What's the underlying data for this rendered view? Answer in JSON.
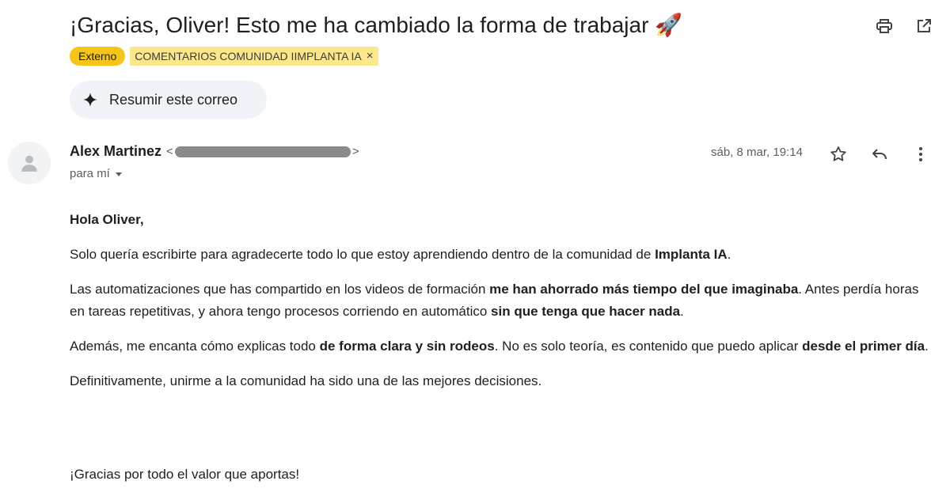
{
  "email": {
    "subject": "¡Gracias, Oliver! Esto me ha cambiado la forma de trabajar",
    "subject_emoji": "🚀",
    "labels": {
      "external": "Externo",
      "tag": "COMENTARIOS COMUNIDAD IIMPLANTA IA",
      "tag_remove": "×"
    },
    "summarize_label": "Resumir este correo",
    "sender": {
      "name": "Alex Martinez",
      "email_open": "<",
      "email_close": ">"
    },
    "to_label": "para mí",
    "date": "sáb, 8 mar, 19:14",
    "body": {
      "greeting": "Hola Oliver,",
      "p1": {
        "a": "Solo quería escribirte para agradecerte todo lo que estoy aprendiendo dentro de la comunidad de ",
        "b": "Implanta IA",
        "c": "."
      },
      "p2": {
        "a": "Las automatizaciones que has compartido en los videos de formación ",
        "b": "me han ahorrado más tiempo del que imaginaba",
        "c": ". Antes perdía horas en tareas repetitivas, y ahora tengo procesos corriendo en automático ",
        "d": "sin que tenga que hacer nada",
        "e": "."
      },
      "p3": {
        "a": "Además, me encanta cómo explicas todo ",
        "b": "de forma clara y sin rodeos",
        "c": ". No es solo teoría, es contenido que puedo aplicar ",
        "d": "desde el primer día",
        "e": "."
      },
      "p4": "Definitivamente, unirme a la comunidad ha sido una de las mejores decisiones.",
      "closing": "¡Gracias por todo el valor que aportas!"
    }
  },
  "icons": {
    "print": "print-icon",
    "open_new_window": "open-in-new-window-icon",
    "sparkle": "sparkle-icon",
    "avatar": "person-icon",
    "dropdown": "caret-down-icon",
    "star": "star-icon",
    "reply": "reply-icon",
    "more": "more-vert-icon"
  },
  "colors": {
    "external_label": "#f5c518",
    "tag_label": "#fce78a",
    "summarize_bg": "#f0f4f9"
  }
}
